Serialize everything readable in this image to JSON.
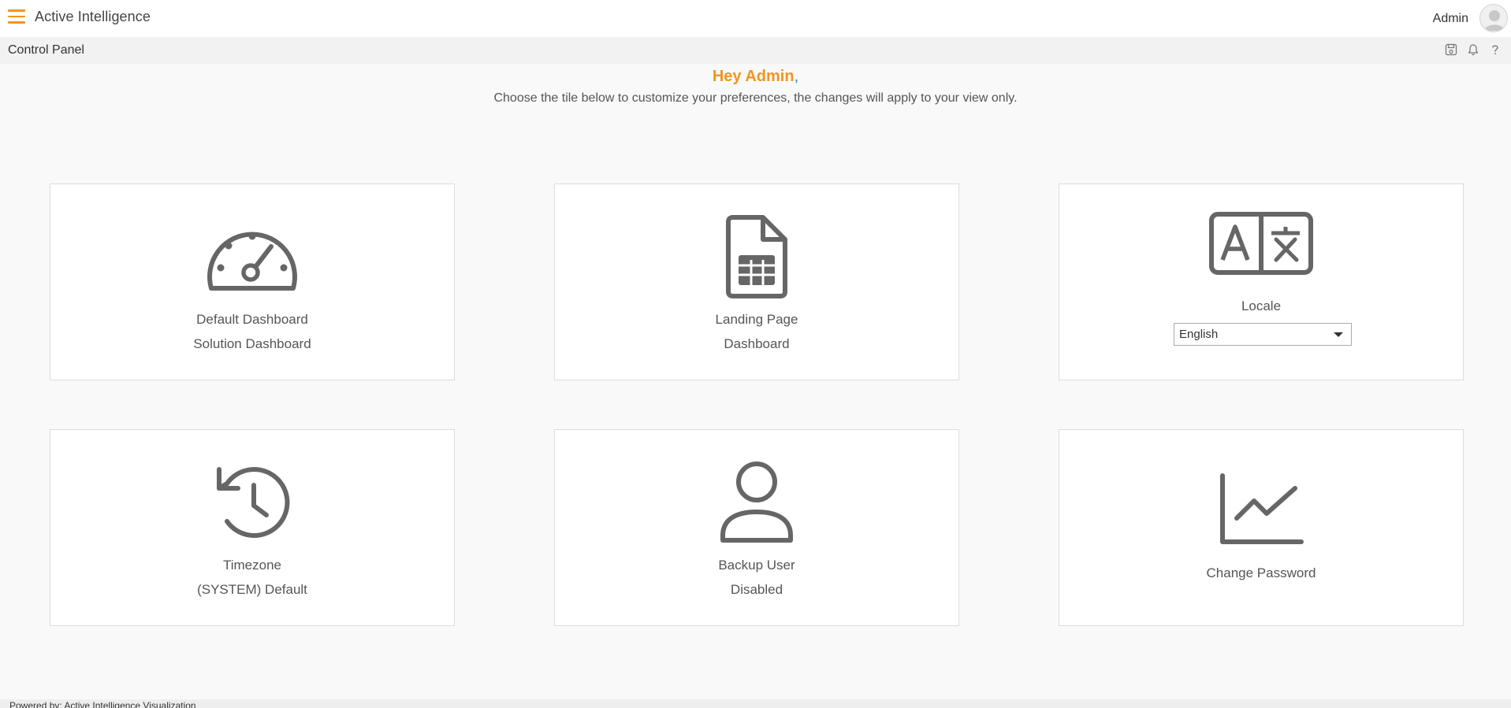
{
  "header": {
    "app_title": "Active Intelligence",
    "user_name": "Admin",
    "accent_color": "#f0951f"
  },
  "subheader": {
    "page_title": "Control Panel",
    "icons": [
      "save-icon",
      "bell-icon",
      "help-icon"
    ]
  },
  "welcome": {
    "greeting": "Hey Admin",
    "comma": ",",
    "subtitle": "Choose the tile below to customize your preferences, the changes will apply to your view only."
  },
  "tiles": {
    "default_dashboard": {
      "title": "Default Dashboard",
      "value": "Solution Dashboard",
      "icon": "gauge-icon"
    },
    "landing_page": {
      "title": "Landing Page",
      "value": "Dashboard",
      "icon": "spreadsheet-file-icon"
    },
    "locale": {
      "title": "Locale",
      "selected": "English",
      "icon": "translate-icon"
    },
    "timezone": {
      "title": "Timezone",
      "value": "(SYSTEM) Default",
      "icon": "history-clock-icon"
    },
    "backup_user": {
      "title": "Backup User",
      "value": "Disabled",
      "icon": "user-icon"
    },
    "change_password": {
      "title": "Change Password",
      "icon": "line-chart-icon"
    }
  },
  "footer": {
    "text": "Powered by: Active Intelligence Visualization"
  }
}
